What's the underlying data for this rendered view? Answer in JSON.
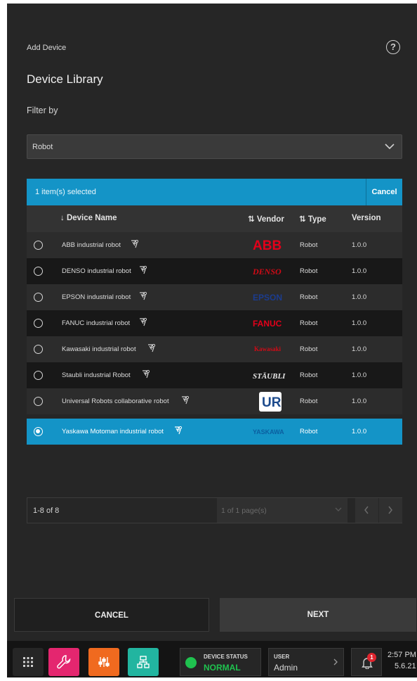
{
  "panel": {
    "title": "Add Device",
    "library_title": "Device Library",
    "filter_label": "Filter by",
    "filter_value": "Robot"
  },
  "selection": {
    "count_text": "1 item(s) selected",
    "cancel_label": "Cancel"
  },
  "table": {
    "headers": {
      "name": "↓ Device Name",
      "vendor": "⇅ Vendor",
      "type": "⇅ Type",
      "version": "Version"
    },
    "rows": [
      {
        "name": "ABB industrial robot",
        "vendor_logo": "ABB",
        "type": "Robot",
        "version": "1.0.0",
        "selected": false
      },
      {
        "name": "DENSO industrial robot",
        "vendor_logo": "DENSO",
        "type": "Robot",
        "version": "1.0.0",
        "selected": false
      },
      {
        "name": "EPSON industrial robot",
        "vendor_logo": "EPSON",
        "type": "Robot",
        "version": "1.0.0",
        "selected": false
      },
      {
        "name": "FANUC industrial robot",
        "vendor_logo": "FANUC",
        "type": "Robot",
        "version": "1.0.0",
        "selected": false
      },
      {
        "name": "Kawasaki industrial robot",
        "vendor_logo": "Kawasaki",
        "type": "Robot",
        "version": "1.0.0",
        "selected": false
      },
      {
        "name": "Staubli industrial Robot",
        "vendor_logo": "STÄUBLI",
        "type": "Robot",
        "version": "1.0.0",
        "selected": false
      },
      {
        "name": "Universal Robots collaborative robot",
        "vendor_logo": "UR",
        "type": "Robot",
        "version": "1.0.0",
        "selected": false
      },
      {
        "name": "Yaskawa Motoman industrial robot",
        "vendor_logo": "YASKAWA",
        "type": "Robot",
        "version": "1.0.0",
        "selected": true
      }
    ]
  },
  "pagination": {
    "range": "1-8 of 8",
    "pages": "1 of 1 page(s)"
  },
  "footer": {
    "cancel_label": "CANCEL",
    "next_label": "NEXT"
  },
  "taskbar": {
    "device_status_label": "DEVICE STATUS",
    "device_status_value": "NORMAL",
    "user_label": "USER",
    "user_value": "Admin",
    "notification_count": "1",
    "time": "2:57 PM",
    "date": "5.6.21"
  },
  "colors": {
    "accent": "#1494c7",
    "status_ok": "#1fc24f",
    "app_wrench": "#e4266f",
    "app_tools": "#f06a1f",
    "app_network": "#22b5a0",
    "abb_red": "#e2001a",
    "denso_red": "#d10a16",
    "epson_blue": "#1b3c8f",
    "ur_blue": "#1c4a8c"
  },
  "icons": [
    "help-icon",
    "chevron-down-icon",
    "robot-arm-icon",
    "grid-menu-icon",
    "wrench-icon",
    "tools-icon",
    "network-icon",
    "bell-icon",
    "chevron-left-icon",
    "chevron-right-icon"
  ]
}
